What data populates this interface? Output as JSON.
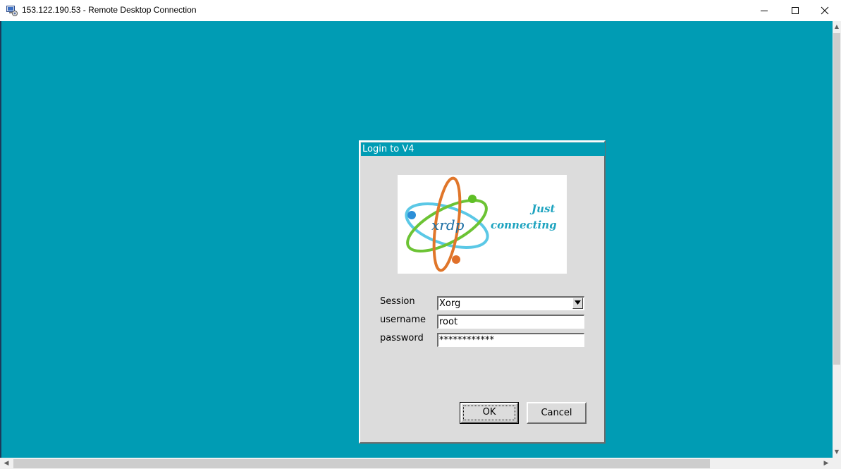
{
  "window": {
    "title": "153.122.190.53 - Remote Desktop Connection",
    "icon": "remote-desktop-icon"
  },
  "colors": {
    "desktop_background": "#009cb4",
    "dialog_background": "#dcdcdc",
    "dialog_title_background": "#009cb4"
  },
  "dialog": {
    "title": "Login to V4",
    "logo": {
      "text": "xrdp",
      "tagline_line1": "Just",
      "tagline_line2": "connecting"
    },
    "session": {
      "label": "Session",
      "value": "Xorg"
    },
    "username": {
      "label": "username",
      "value": "root"
    },
    "password": {
      "label": "password",
      "value": "************"
    },
    "ok_label": "OK",
    "cancel_label": "Cancel"
  }
}
